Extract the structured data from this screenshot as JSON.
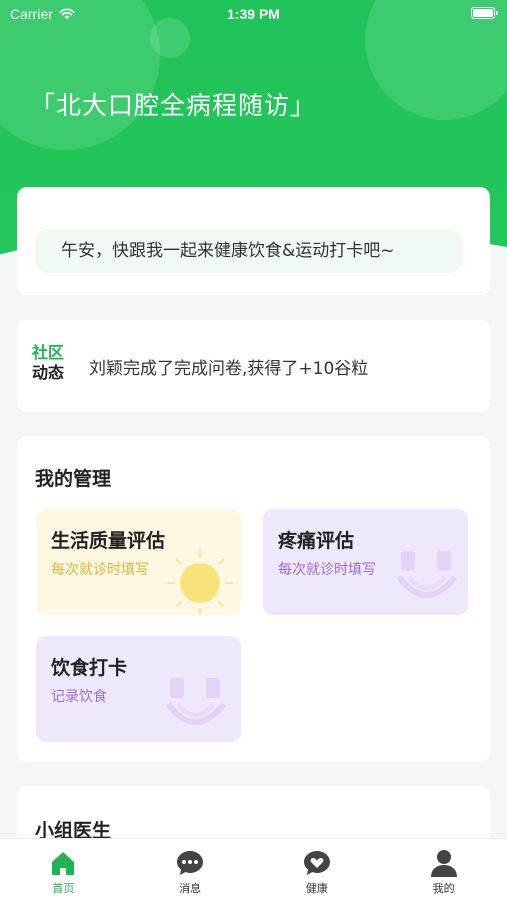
{
  "status_bar": {
    "carrier": "Carrier",
    "time": "1:39 PM",
    "battery_level": 1.0
  },
  "hero": {
    "title": "「北大口腔全病程随访」"
  },
  "greeting": {
    "text": "午安，快跟我一起来健康饮食&运动打卡吧~"
  },
  "community": {
    "logo_line1": "社区",
    "logo_line2": "动态",
    "feed_text": "刘颖完成了完成问卷,获得了+10谷粒"
  },
  "management": {
    "title": "我的管理",
    "tiles": [
      {
        "title": "生活质量评估",
        "subtitle": "每次就诊时填写",
        "icon": "sun-icon"
      },
      {
        "title": "疼痛评估",
        "subtitle": "每次就诊时填写",
        "icon": "face-icon"
      },
      {
        "title": "饮食打卡",
        "subtitle": "记录饮食",
        "icon": "face-icon"
      }
    ]
  },
  "group_doctor": {
    "title": "小组医生"
  },
  "tab_bar": {
    "items": [
      {
        "label": "首页",
        "icon": "home-icon",
        "active": true
      },
      {
        "label": "消息",
        "icon": "chat-icon",
        "active": false
      },
      {
        "label": "健康",
        "icon": "heart-icon",
        "active": false
      },
      {
        "label": "我的",
        "icon": "user-icon",
        "active": false
      }
    ]
  },
  "colors": {
    "brand_green": "#22c55e",
    "tab_active": "#20b354",
    "yellow_tile": "#fdf8e1",
    "purple_tile": "#efe8fb"
  }
}
